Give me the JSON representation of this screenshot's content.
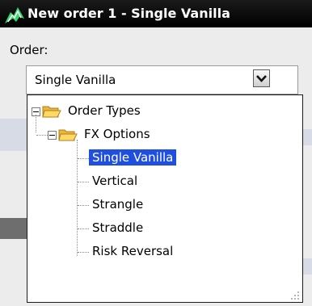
{
  "window": {
    "title": "New order 1 - Single Vanilla",
    "icon": "app-logo-icon"
  },
  "form": {
    "order_label": "Order:",
    "order_value": "Single Vanilla"
  },
  "tree": {
    "root": "Order Types",
    "group": "FX Options",
    "items": [
      "Single Vanilla",
      "Vertical",
      "Strangle",
      "Straddle",
      "Risk Reversal"
    ],
    "selected": "Single Vanilla"
  },
  "colors": {
    "titlebar": "#000000",
    "selection": "#1f4fe0",
    "window_bg": "#ececec"
  }
}
